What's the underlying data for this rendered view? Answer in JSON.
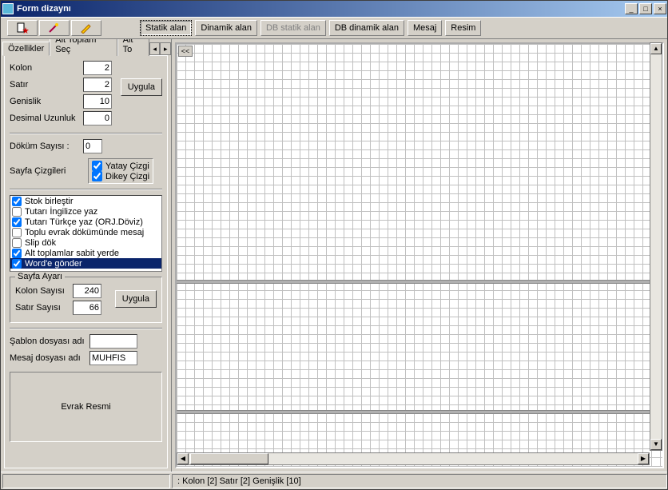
{
  "window": {
    "title": "Form dizaynı"
  },
  "toolbar": {
    "statik": "Statik alan",
    "dinamik": "Dinamik alan",
    "db_statik": "DB statik alan",
    "db_dinamik": "DB dinamik alan",
    "mesaj": "Mesaj",
    "resim": "Resim"
  },
  "tabs": {
    "ozellikler": "Özellikler",
    "alt_toplam": "Alt Toplam Seç",
    "alt_to": "Alt To"
  },
  "props": {
    "kolon_label": "Kolon",
    "kolon": "2",
    "satir_label": "Satır",
    "satir": "2",
    "genislik_label": "Genislik",
    "genislik": "10",
    "desimal_label": "Desimal Uzunluk",
    "desimal": "0",
    "uygula": "Uygula",
    "dokum_label": "Döküm Sayısı :",
    "dokum": "0",
    "sayfa_cizgileri": "Sayfa Çizgileri",
    "yatay": "Yatay Çizgi",
    "dikey": "Dikey Çizgi"
  },
  "options": [
    {
      "label": "Stok birleştir",
      "checked": true
    },
    {
      "label": "Tutarı İngilizce yaz",
      "checked": false
    },
    {
      "label": "Tutarı Türkçe yaz (ORJ.Döviz)",
      "checked": true
    },
    {
      "label": "Toplu evrak dökümünde mesaj",
      "checked": false
    },
    {
      "label": "Slip dök",
      "checked": false
    },
    {
      "label": "Alt toplamlar sabit yerde",
      "checked": true
    },
    {
      "label": "Word'e gönder",
      "checked": true,
      "selected": true
    }
  ],
  "sayfa_ayari": {
    "legend": "Sayfa Ayarı",
    "kolon_label": "Kolon Sayısı",
    "kolon": "240",
    "satir_label": "Satır Sayısı",
    "satir": "66",
    "uygula": "Uygula"
  },
  "files": {
    "sablon_label": "Şablon dosyası adı",
    "sablon_val": "",
    "mesaj_label": "Mesaj dosyası adı",
    "mesaj_val": "MUHFIS"
  },
  "evrak": "Evrak Resmi",
  "canvas": {
    "corner": "<<"
  },
  "status": {
    "text": ": Kolon [2]  Satır [2]  Genişlik [10]"
  }
}
